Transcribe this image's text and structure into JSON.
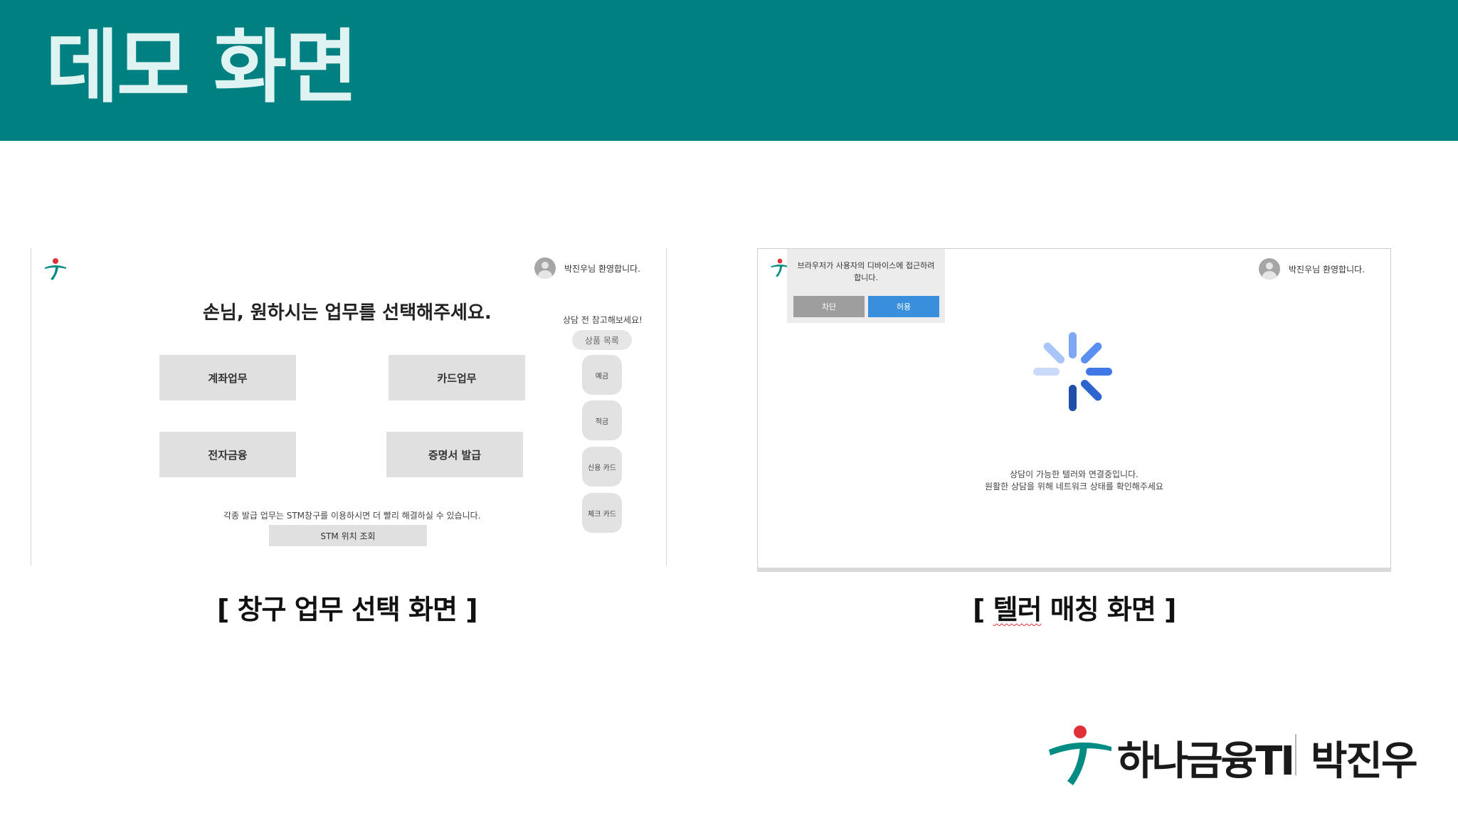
{
  "header": {
    "title": "데모 화면",
    "background": "#008080",
    "title_color": "#dff3f3"
  },
  "left_screen": {
    "welcome": "박진우님 환영합니다.",
    "heading": "손님, 원하시는 업무를 선택해주세요.",
    "tasks": [
      "계좌업무",
      "카드업무",
      "전자금융",
      "증명서 발급"
    ],
    "note": "각종 발급 업무는 STM창구를 이용하시면 더 빨리 해결하실 수 있습니다.",
    "stm_button": "STM 위치 조회",
    "side_caption": "상담 전 참고해보세요!",
    "product_pill": "상품 목록",
    "categories": [
      "예금",
      "적금",
      "신용 카드",
      "체크 카드"
    ]
  },
  "right_screen": {
    "welcome": "박진우님 환영합니다.",
    "permission": {
      "line1": "브라우저가 사용자의 디바이스에 접근하려",
      "line2": "합니다.",
      "block": "차단",
      "allow": "허용",
      "block_color": "#9e9e9e",
      "allow_color": "#3a8fdc"
    },
    "status_line1": "상담이 가능한 텔러와 연결중입니다.",
    "status_line2": "원활한 상담을 위해 네트워크 상태를 확인해주세요",
    "spinner_colors": [
      "#1f4fa8",
      "#2e64cf",
      "#3f78e6",
      "#5a8ef0",
      "#7fa8f4",
      "#a9c4f7",
      "#c8d9fa"
    ]
  },
  "captions": {
    "left": "[ 창구 업무 선택 화면 ]",
    "right_prefix": "[ ",
    "right_word": "텔러",
    "right_suffix": " 매칭 화면 ]"
  },
  "footer": {
    "brand": "하나금융TI",
    "author": "박진우",
    "brand_green": "#008C83",
    "brand_red": "#E0313B"
  }
}
